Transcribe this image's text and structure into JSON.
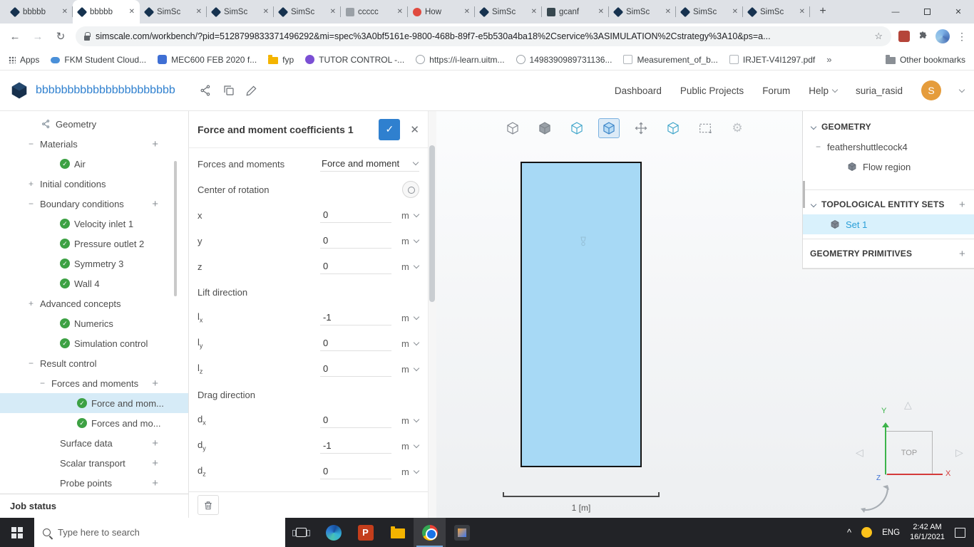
{
  "icons": {
    "check": "✓",
    "close": "✕",
    "plus": "+",
    "minus": "−",
    "back": "←",
    "forward": "→",
    "reload": "↻",
    "star": "☆",
    "menu": "⋮",
    "overflow": "»",
    "new_tab": "+",
    "window_min": "—",
    "tray_chevron": "^",
    "gear": "⚙",
    "tri_up": "△",
    "tri_left": "◁",
    "tri_right": "▷"
  },
  "browser": {
    "tabs": [
      {
        "label": "bbbbb"
      },
      {
        "label": "bbbbb"
      },
      {
        "label": "SimSc"
      },
      {
        "label": "SimSc"
      },
      {
        "label": "SimSc"
      },
      {
        "label": "ccccc"
      },
      {
        "label": "How"
      },
      {
        "label": "SimSc"
      },
      {
        "label": "gcanf"
      },
      {
        "label": "SimSc"
      },
      {
        "label": "SimSc"
      },
      {
        "label": "SimSc"
      }
    ],
    "active_tab_index": 1,
    "url": "simscale.com/workbench/?pid=5128799833371496292&mi=spec%3A0bf5161e-9800-468b-89f7-e5b530a4ba18%2Cservice%3ASIMULATION%2Cstrategy%3A10&ps=a...",
    "bookmarks": {
      "apps_label": "Apps",
      "items": [
        {
          "label": "FKM Student Cloud..."
        },
        {
          "label": "MEC600 FEB 2020 f..."
        },
        {
          "label": "fyp"
        },
        {
          "label": "TUTOR CONTROL -..."
        },
        {
          "label": "https://i-learn.uitm..."
        },
        {
          "label": "1498390989731136..."
        },
        {
          "label": "Measurement_of_b..."
        },
        {
          "label": "IRJET-V4I1297.pdf"
        }
      ],
      "overflow": "»",
      "other_label": "Other bookmarks"
    }
  },
  "app_header": {
    "project_title": "bbbbbbbbbbbbbbbbbbbbbb",
    "nav": [
      {
        "label": "Dashboard"
      },
      {
        "label": "Public Projects"
      },
      {
        "label": "Forum"
      },
      {
        "label": "Help"
      }
    ],
    "username": "suria_rasid",
    "avatar_letter": "S"
  },
  "tree": {
    "items": [
      {
        "label": "Geometry"
      },
      {
        "label": "Materials"
      },
      {
        "label": "Air"
      },
      {
        "label": "Initial conditions"
      },
      {
        "label": "Boundary conditions"
      },
      {
        "label": "Velocity inlet 1"
      },
      {
        "label": "Pressure outlet 2"
      },
      {
        "label": "Symmetry 3"
      },
      {
        "label": "Wall 4"
      },
      {
        "label": "Advanced concepts"
      },
      {
        "label": "Numerics"
      },
      {
        "label": "Simulation control"
      },
      {
        "label": "Result control"
      },
      {
        "label": "Forces and moments"
      },
      {
        "label": "Force and mom..."
      },
      {
        "label": "Forces and mo..."
      },
      {
        "label": "Surface data"
      },
      {
        "label": "Scalar transport"
      },
      {
        "label": "Probe points"
      }
    ],
    "job_status_label": "Job status"
  },
  "panel": {
    "title": "Force and moment coefficients 1",
    "forces_label": "Forces and moments",
    "forces_value": "Force and moment",
    "center_label": "Center of rotation",
    "lift_label": "Lift direction",
    "drag_label": "Drag direction",
    "fields": {
      "x": {
        "label": "x",
        "value": "0",
        "unit": "m"
      },
      "y": {
        "label": "y",
        "value": "0",
        "unit": "m"
      },
      "z": {
        "label": "z",
        "value": "0",
        "unit": "m"
      },
      "lx": {
        "base": "l",
        "sub": "x",
        "value": "-1",
        "unit": "m"
      },
      "ly": {
        "base": "l",
        "sub": "y",
        "value": "0",
        "unit": "m"
      },
      "lz": {
        "base": "l",
        "sub": "z",
        "value": "0",
        "unit": "m"
      },
      "dx": {
        "base": "d",
        "sub": "x",
        "value": "0",
        "unit": "m"
      },
      "dy": {
        "base": "d",
        "sub": "y",
        "value": "-1",
        "unit": "m"
      },
      "dz": {
        "base": "d",
        "sub": "z",
        "value": "0",
        "unit": "m"
      }
    }
  },
  "viewport": {
    "scale_label": "1 [m]",
    "nav_cube": {
      "face_label": "TOP",
      "x": "X",
      "y": "Y",
      "z": "Z"
    }
  },
  "right_panel": {
    "geometry_title": "GEOMETRY",
    "geometry_item": "feathershuttlecock4",
    "geometry_child": "Flow region",
    "topo_title": "TOPOLOGICAL ENTITY SETS",
    "topo_item": "Set 1",
    "primitives_title": "GEOMETRY PRIMITIVES"
  },
  "taskbar": {
    "search_placeholder": "Type here to search",
    "language": "ENG",
    "time": "2:42 AM",
    "date": "16/1/2021"
  }
}
